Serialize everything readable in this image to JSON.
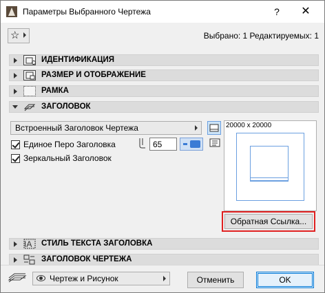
{
  "window": {
    "title": "Параметры Выбранного Чертежа",
    "help": "?",
    "close": "✕"
  },
  "header": {
    "selected_info": "Выбрано: 1 Редактируемых: 1"
  },
  "panels": [
    {
      "label": "ИДЕНТИФИКАЦИЯ",
      "expanded": false
    },
    {
      "label": "РАЗМЕР И ОТОБРАЖЕНИЕ",
      "expanded": false
    },
    {
      "label": "РАМКА",
      "expanded": false
    },
    {
      "label": "ЗАГОЛОВОК",
      "expanded": true
    },
    {
      "label": "СТИЛЬ ТЕКСТА ЗАГОЛОВКА",
      "expanded": false
    },
    {
      "label": "ЗАГОЛОВОК ЧЕРТЕЖА",
      "expanded": false
    }
  ],
  "title_section": {
    "title_type": "Встроенный Заголовок Чертежа",
    "single_pen_label": "Единое Перо Заголовка",
    "single_pen_checked": true,
    "pen_value": "65",
    "mirror_label": "Зеркальный Заголовок",
    "mirror_checked": true,
    "preview_size": "20000 x 20000",
    "reverse_link_button": "Обратная Ссылка..."
  },
  "footer": {
    "view_option": "Чертеж и Рисунок",
    "cancel": "Отменить",
    "ok": "OK"
  },
  "colors": {
    "highlight_border": "#e02020",
    "ok_accent": "#0078d7",
    "preview_line": "#6a9fe0"
  }
}
